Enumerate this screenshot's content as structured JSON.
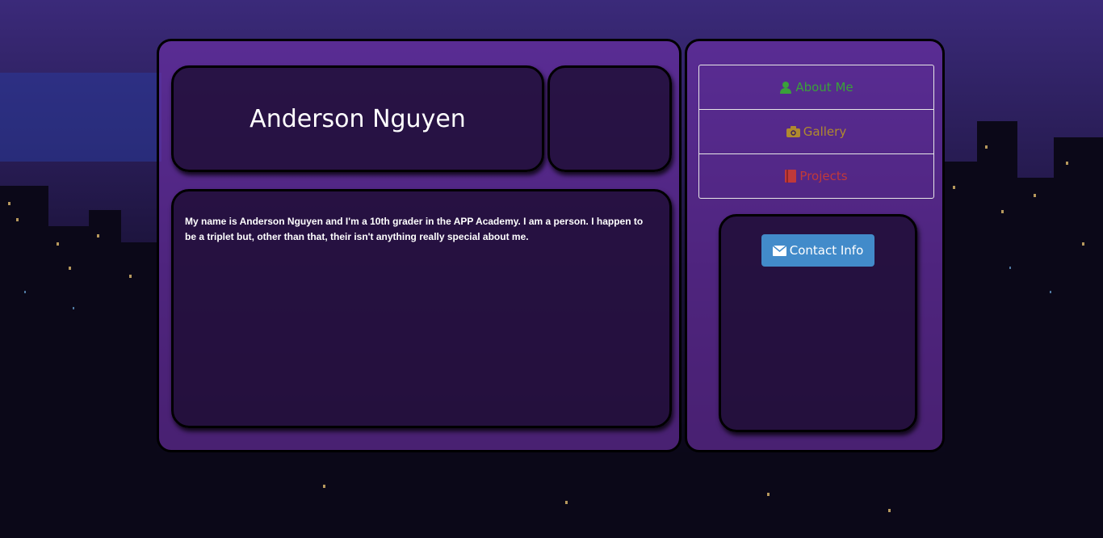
{
  "profile": {
    "name": "Anderson Nguyen",
    "bio": "My name is Anderson Nguyen and I'm a 10th grader in the APP Academy. I am a person. I happen to be a triplet but, other than that, their isn't anything really special about me."
  },
  "nav": {
    "items": [
      {
        "label": "About Me",
        "icon": "user-icon",
        "color": "#3aa13a"
      },
      {
        "label": "Gallery",
        "icon": "camera-icon",
        "color": "#b08a2e"
      },
      {
        "label": "Projects",
        "icon": "book-icon",
        "color": "#c0393a"
      }
    ]
  },
  "contact": {
    "label": "Contact Info",
    "icon": "envelope-icon",
    "color": "#428bca"
  }
}
